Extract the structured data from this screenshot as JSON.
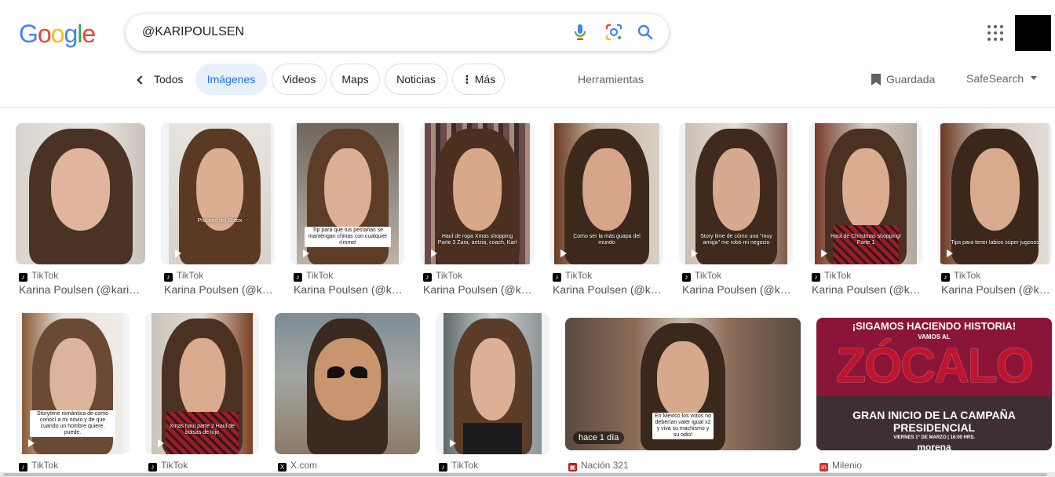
{
  "logo": {
    "letters": [
      "G",
      "o",
      "o",
      "g",
      "l",
      "e"
    ],
    "colors": [
      "#4285F4",
      "#EA4335",
      "#FBBC05",
      "#4285F4",
      "#34A853",
      "#EA4335"
    ]
  },
  "search": {
    "query": "@KARIPOULSEN"
  },
  "nav": {
    "todos": "Todos",
    "tabs": [
      "Imágenes",
      "Videos",
      "Maps",
      "Noticias",
      "Más"
    ],
    "tools": "Herramientas",
    "saved": "Guardada",
    "safesearch": "SafeSearch"
  },
  "row1": [
    {
      "source": "TikTok",
      "title": "Karina Poulsen (@kari…",
      "caption": ""
    },
    {
      "source": "TikTok",
      "title": "Karina Poulsen (@k…",
      "caption": "Proceso del Botox"
    },
    {
      "source": "TikTok",
      "title": "Karina Poulsen (@k…",
      "caption": "Tip para que tus pestañas se mantengan chinas con cualquier rímmel"
    },
    {
      "source": "TikTok",
      "title": "Karina Poulsen (@k…",
      "caption": "Haul de ropa Xmas shopping Parte 3 Zara, aritzia, coach, Karl"
    },
    {
      "source": "TikTok",
      "title": "Karina Poulsen (@k…",
      "caption": "Como ser la más guapa del mundo"
    },
    {
      "source": "TikTok",
      "title": "Karina Poulsen (@k…",
      "caption": "Story time de cómo una \"muy amiga\" me robó mi negocio"
    },
    {
      "source": "TikTok",
      "title": "Karina Poulsen (@k…",
      "caption": "Haul de Christmas shopping! Parte 1"
    },
    {
      "source": "TikTok",
      "title": "Karina Poulsen (@k…",
      "caption": "Tips para tener labios súper jugosos"
    }
  ],
  "row2": [
    {
      "source": "TikTok",
      "caption": "Storytime romántica de como conocí a mi novio y de que cuando un hombre quiere, puede."
    },
    {
      "source": "TikTok",
      "caption": "Xmas haul parte 2 Haul de bolsas de lujo"
    },
    {
      "source": "X.com",
      "caption": ""
    },
    {
      "source": "TikTok",
      "caption": ""
    },
    {
      "source": "Nación 321",
      "caption": "En México los votos no deberían valer igual x2 y viva su machismo y su odio!",
      "badge": "hace 1 día"
    },
    {
      "source": "Milenio",
      "caption": ""
    }
  ],
  "poster": {
    "line1": "¡SIGAMOS HACIENDO HISTORIA!",
    "line2": "VAMOS AL",
    "line3": "ZÓCALO",
    "line4": "GRAN INICIO DE LA CAMPAÑA PRESIDENCIAL",
    "line5": "VIERNES 1° DE MARZO | 16:00 HRS.",
    "line6": "morena"
  }
}
